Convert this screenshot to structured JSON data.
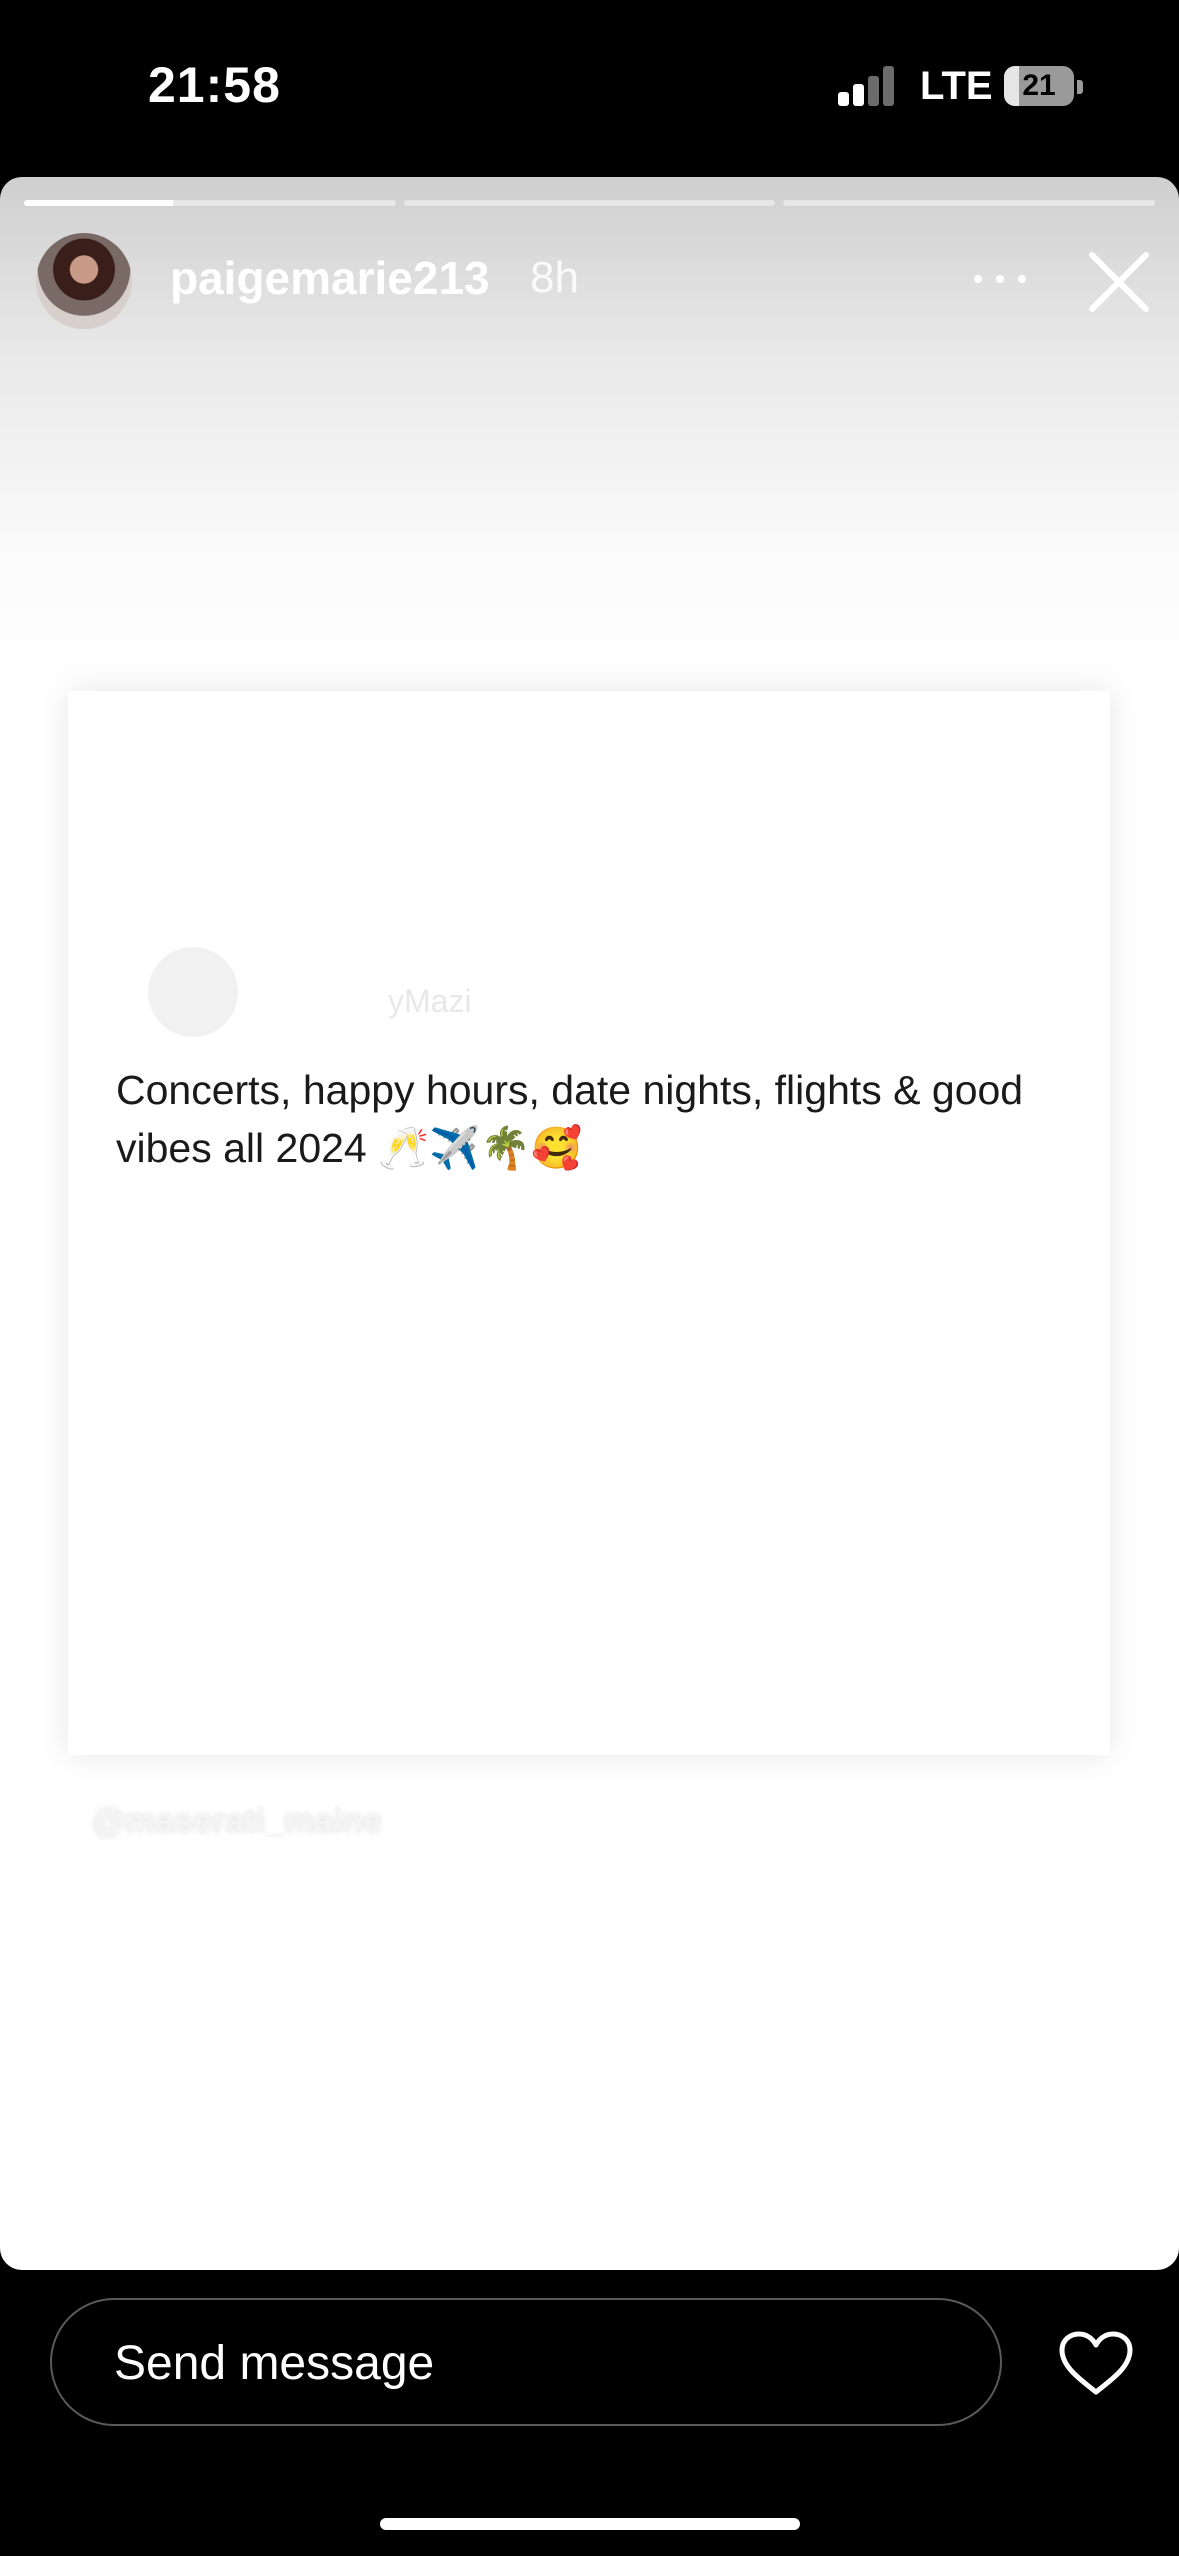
{
  "status_bar": {
    "time": "21:58",
    "network": "LTE",
    "battery_level": "21",
    "battery_fraction": 0.21,
    "signal_bars_active": 2,
    "signal_bars_total": 4
  },
  "story": {
    "progress_segments_total": 3,
    "progress_current_fill": 0.4,
    "username": "paigemarie213",
    "time_ago": "8h",
    "avatar_icon": "profile-avatar",
    "more_icon": "more-horizontal-icon",
    "close_icon": "close-icon",
    "post": {
      "handle_partial": "yMazi",
      "text": "Concerts, happy hours, date nights, flights & good vibes all 2024 🥂✈️🌴🥰"
    },
    "watermark": "@maserati_maine"
  },
  "footer": {
    "send_message_placeholder": "Send message",
    "like_icon": "heart-icon"
  }
}
